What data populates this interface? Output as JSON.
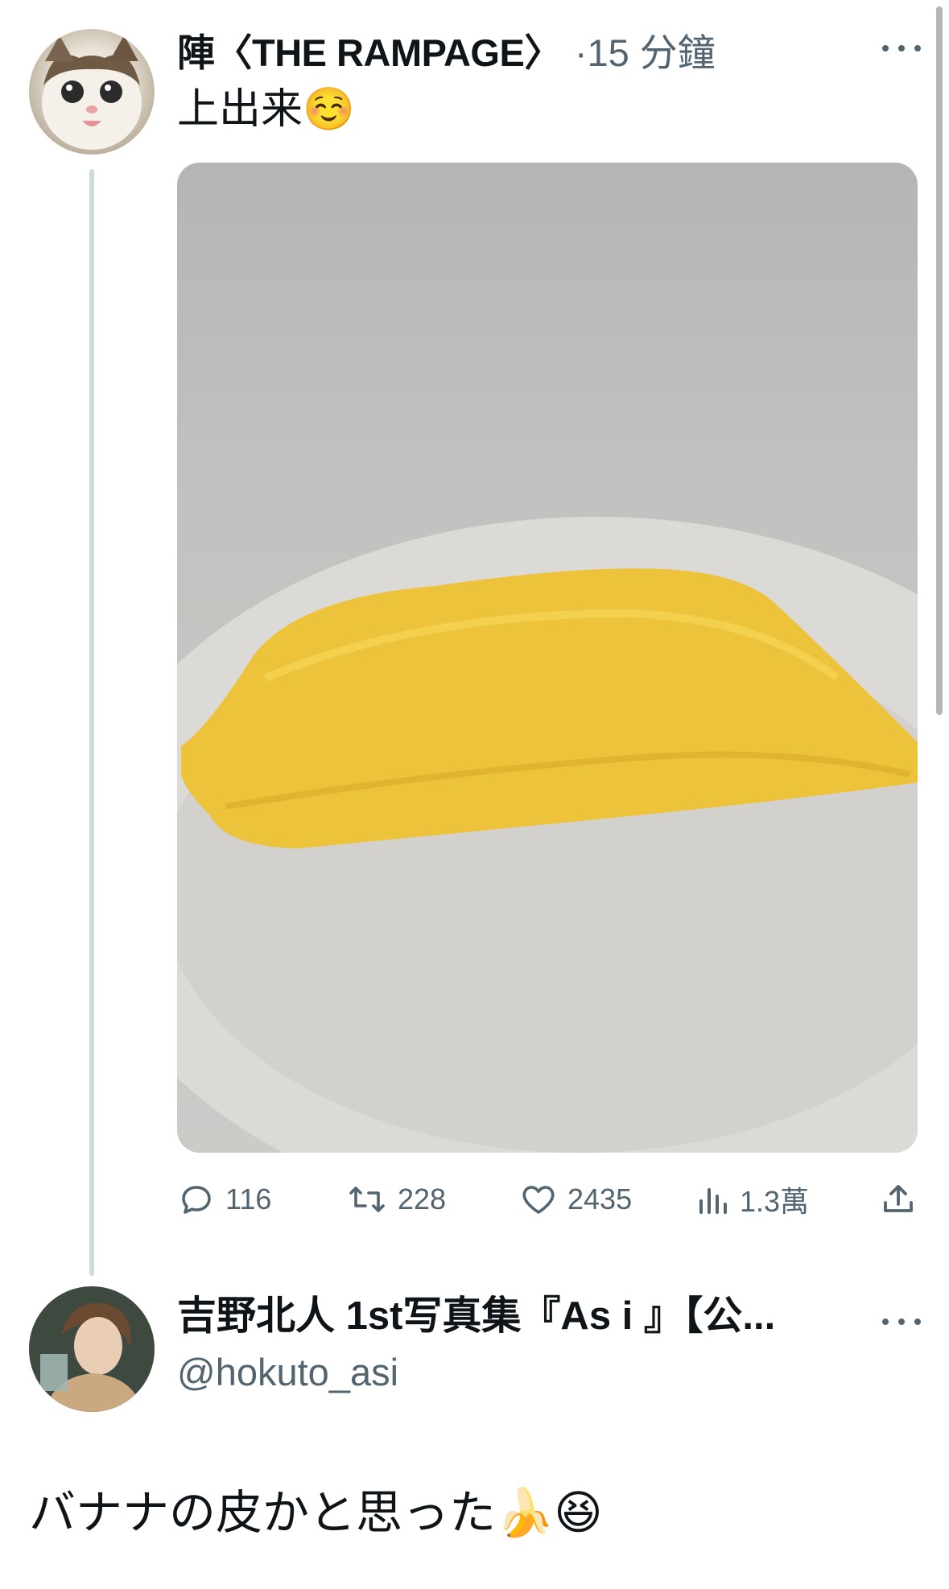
{
  "tweet1": {
    "display_name": "陣〈THE RAMPAGE〉",
    "time": "·15 分鐘",
    "text": "上出来☺️",
    "avatar_icon": "cat-avatar",
    "media_icon": "omelette-on-plate-photo",
    "actions": {
      "replies": "116",
      "retweets": "228",
      "likes": "2435",
      "views": "1.3萬"
    }
  },
  "tweet2": {
    "display_name": "吉野北人 1st写真集『As i 』【公...",
    "handle": "@hokuto_asi",
    "text": "バナナの皮かと思った🍌😆",
    "avatar_icon": "person-avatar"
  },
  "colors": {
    "text_primary": "#0f1419",
    "text_secondary": "#536471",
    "thread_line": "#cfd9de"
  }
}
